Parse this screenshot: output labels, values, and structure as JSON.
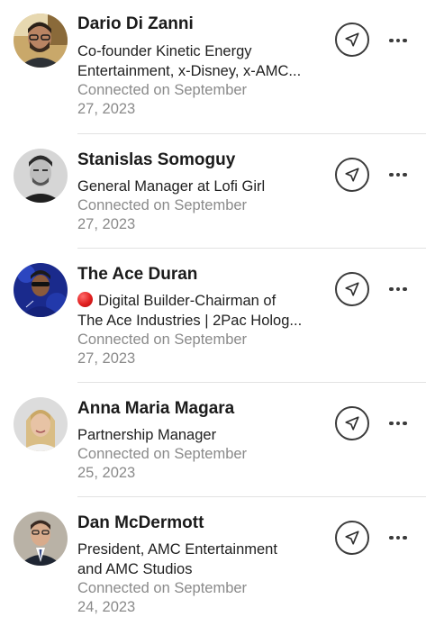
{
  "connections": [
    {
      "name": "Dario Di Zanni",
      "headline_lines": [
        "Co-founder Kinetic Energy",
        "Entertainment, x-Disney, x-AMC..."
      ],
      "connected_lines": [
        "Connected on September",
        "27, 2023"
      ],
      "avatar_icon": "person-photo-beard-glasses",
      "has_status_dot": false
    },
    {
      "name": "Stanislas Somoguy",
      "headline_lines": [
        "General Manager at Lofi Girl"
      ],
      "connected_lines": [
        "Connected on September",
        "27, 2023"
      ],
      "avatar_icon": "person-photo-bw",
      "has_status_dot": false
    },
    {
      "name": "The Ace Duran",
      "headline_lines": [
        "Digital Builder-Chairman of",
        "The Ace Industries | 2Pac Holog..."
      ],
      "connected_lines": [
        "Connected on September",
        "27, 2023"
      ],
      "avatar_icon": "person-photo-blue-sunglasses",
      "has_status_dot": true,
      "status_dot_color": "#e01e1e"
    },
    {
      "name": "Anna Maria Magara",
      "headline_lines": [
        "Partnership Manager"
      ],
      "connected_lines": [
        "Connected on September",
        "25, 2023"
      ],
      "avatar_icon": "person-photo-blonde",
      "has_status_dot": false
    },
    {
      "name": "Dan McDermott",
      "headline_lines": [
        "President, AMC Entertainment",
        "and AMC Studios"
      ],
      "connected_lines": [
        "Connected on September",
        "24, 2023"
      ],
      "avatar_icon": "person-photo-suit",
      "has_status_dot": false
    }
  ],
  "actions": {
    "message_icon": "send-paper-plane-icon",
    "more_icon": "more-horizontal-icon"
  },
  "colors": {
    "name": "#1b1b1b",
    "headline": "#1f1f1f",
    "meta": "#8a8a8a",
    "divider": "#e2e2e2",
    "icon": "#3c3c3c"
  }
}
